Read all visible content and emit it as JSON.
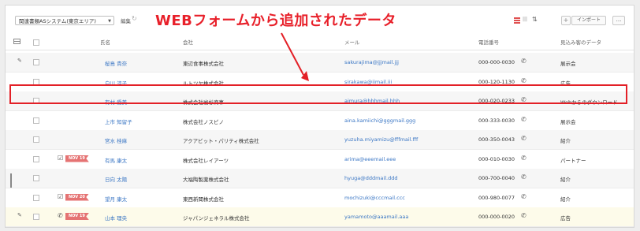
{
  "toolbar": {
    "view_name": "関連書類ASシステム(東京エリア)",
    "edit_label": "編集",
    "import_label": "インポート",
    "add_label": "+",
    "more_label": "..."
  },
  "annotation": {
    "headline": "WEBフォームから追加されたデータ"
  },
  "columns": [
    "氏名",
    "会社",
    "メール",
    "電話番号",
    "見込み客のデータ"
  ],
  "rows": [
    {
      "name": "桜島 貴奈",
      "company": "東辺食事株式会社",
      "email": "sakurajima@jjjmail.jjj",
      "phone": "000-000-0030",
      "source": "展示会",
      "pencil": true,
      "task": false,
      "badge": ""
    },
    {
      "name": "白川 涼子",
      "company": "ルトツヤ株式会社",
      "email": "sirakawa@iimail.iii",
      "phone": "000-120-1130",
      "source": "広告",
      "pencil": false,
      "task": false,
      "badge": ""
    },
    {
      "name": "有村 愛美",
      "company": "株式会社岩杉商事",
      "email": "aimura@hhhmail.hhh",
      "phone": "000-020-0233",
      "source": "Webからのダウンロード",
      "pencil": false,
      "task": false,
      "badge": ""
    },
    {
      "name": "上市 知留子",
      "company": "株式会社ノスピノ",
      "email": "aina.kamiichi@gggmail.ggg",
      "phone": "000-333-0030",
      "source": "展示会",
      "pencil": false,
      "task": false,
      "badge": ""
    },
    {
      "name": "宮水 桂麻",
      "company": "アクアビット・パリティ株式会社",
      "email": "yuzuha.miyamizu@fffmail.fff",
      "phone": "000-350-0043",
      "source": "紹介",
      "pencil": false,
      "task": false,
      "badge": ""
    },
    {
      "name": "有馬 康太",
      "company": "株式会社レイアーツ",
      "email": "arima@eeemail.eee",
      "phone": "000-010-0030",
      "source": "パートナー",
      "pencil": false,
      "task": true,
      "badge": "NOV 19"
    },
    {
      "name": "日向 太陽",
      "company": "大福陶製薬株式会社",
      "email": "hyuga@dddmail.ddd",
      "phone": "000-700-0040",
      "source": "紹介",
      "pencil": false,
      "task": false,
      "badge": ""
    },
    {
      "name": "望月 康太",
      "company": "東西新聞株式会社",
      "email": "mochizuki@cccmail.ccc",
      "phone": "000-980-0077",
      "source": "紹介",
      "pencil": false,
      "task": true,
      "badge": "NOV 20"
    },
    {
      "name": "山本 理央",
      "company": "ジャパンジェネラル株式会社",
      "email": "yamamoto@aaamail.aaa",
      "phone": "000-000-0020",
      "source": "広告",
      "pencil": true,
      "task": false,
      "badge": "NOV 19",
      "phone_task": true
    }
  ]
}
